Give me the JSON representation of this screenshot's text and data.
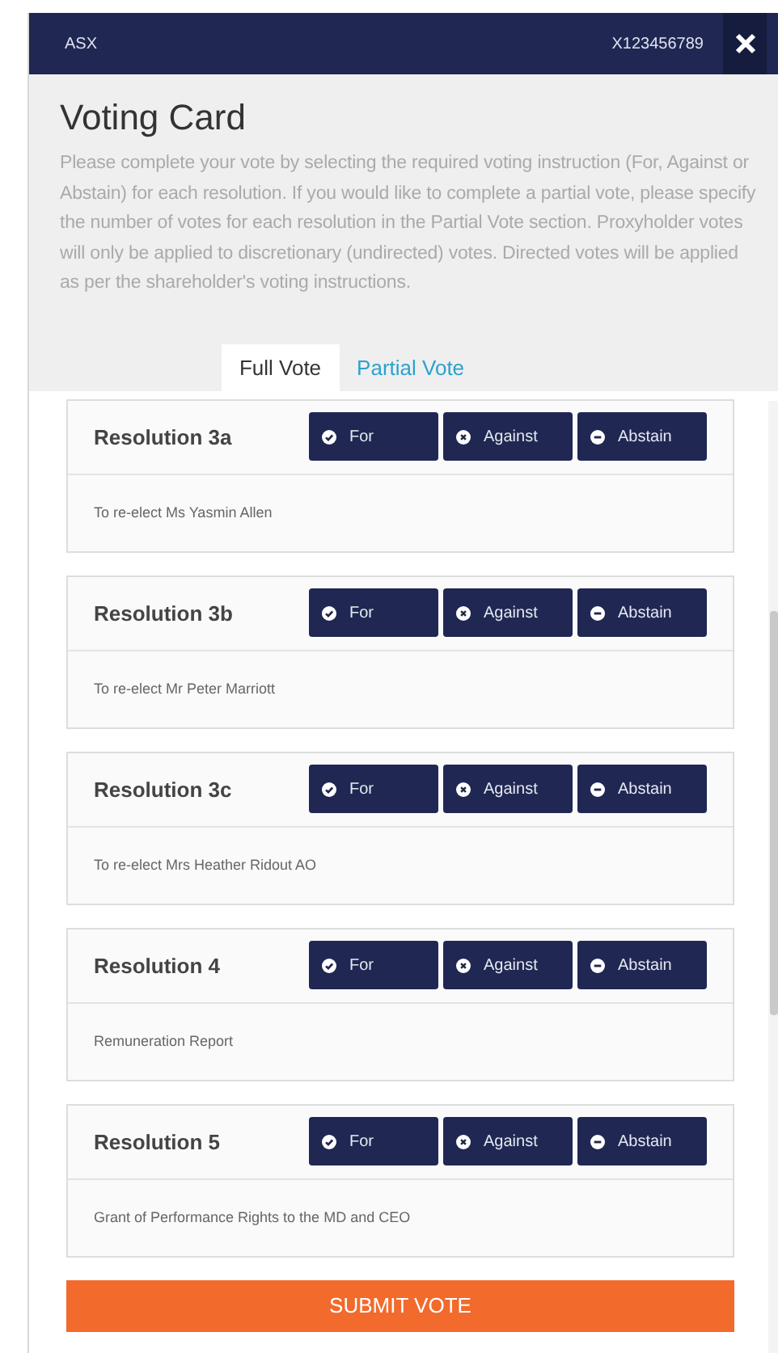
{
  "header": {
    "exchange": "ASX",
    "holder_id": "X123456789"
  },
  "title": "Voting Card",
  "description": "Please complete your vote by selecting the required voting instruction (For, Against or Abstain) for each resolution. If you would like to complete a partial vote, please specify the number of votes for each resolution in the Partial Vote section. Proxyholder votes will only be applied to discretionary (undirected) votes. Directed votes will be applied as per the shareholder's voting instructions.",
  "tabs": [
    {
      "label": "Full Vote",
      "selected": true
    },
    {
      "label": "Partial Vote",
      "selected": false
    }
  ],
  "resolutions": [
    {
      "title": "Resolution 3a",
      "text": "To re-elect Ms Yasmin Allen",
      "vote_options": [
        {
          "label": "For",
          "kind": "check"
        },
        {
          "label": "Against",
          "kind": "cross"
        },
        {
          "label": "Abstain",
          "kind": "minus"
        }
      ]
    },
    {
      "title": "Resolution 3b",
      "text": "To re-elect Mr Peter Marriott",
      "vote_options": [
        {
          "label": "For",
          "kind": "check"
        },
        {
          "label": "Against",
          "kind": "cross"
        },
        {
          "label": "Abstain",
          "kind": "minus"
        }
      ]
    },
    {
      "title": "Resolution 3c",
      "text": "To re-elect Mrs Heather Ridout AO",
      "vote_options": [
        {
          "label": "For",
          "kind": "check"
        },
        {
          "label": "Against",
          "kind": "cross"
        },
        {
          "label": "Abstain",
          "kind": "minus"
        }
      ]
    },
    {
      "title": "Resolution 4",
      "text": "Remuneration Report",
      "vote_options": [
        {
          "label": "For",
          "kind": "check"
        },
        {
          "label": "Against",
          "kind": "cross"
        },
        {
          "label": "Abstain",
          "kind": "minus"
        }
      ]
    },
    {
      "title": "Resolution 5",
      "text": "Grant of Performance Rights to the MD and CEO",
      "vote_options": [
        {
          "label": "For",
          "kind": "check"
        },
        {
          "label": "Against",
          "kind": "cross"
        },
        {
          "label": "Abstain",
          "kind": "minus"
        }
      ]
    }
  ],
  "submit": "SUBMIT VOTE"
}
